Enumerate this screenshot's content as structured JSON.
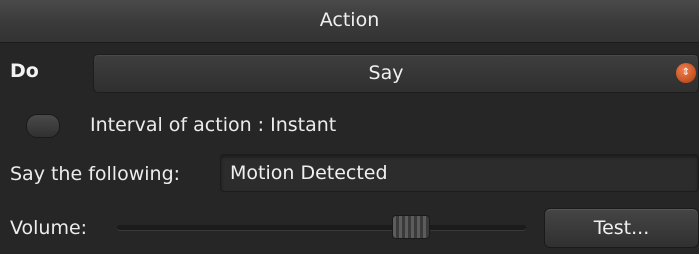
{
  "header": {
    "title": "Action"
  },
  "do": {
    "label": "Do",
    "selected": "Say"
  },
  "interval": {
    "label": "Interval of action : Instant",
    "toggle_on": false
  },
  "say": {
    "label": "Say the following:",
    "value": "Motion Detected"
  },
  "volume": {
    "label": "Volume:",
    "level_fraction": 0.69
  },
  "test_button": {
    "label": "Test..."
  },
  "colors": {
    "accent": "#d8602c",
    "background": "#262626"
  }
}
